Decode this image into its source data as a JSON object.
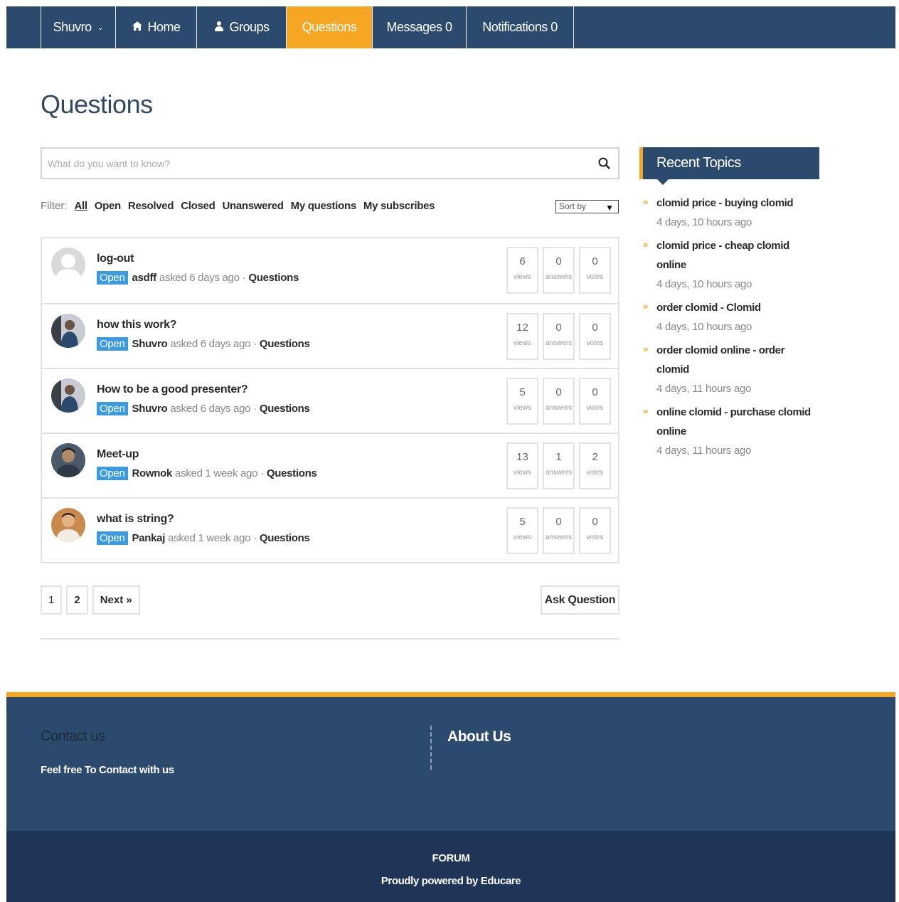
{
  "nav": {
    "user": "Shuvro",
    "home": "Home",
    "groups": "Groups",
    "questions": "Questions",
    "messages": "Messages 0",
    "notifications": "Notifications 0",
    "accent": "#f5a623",
    "bar_color": "#2c4a6e"
  },
  "page": {
    "title": "Questions"
  },
  "search": {
    "placeholder": "What do you want to know?"
  },
  "filter": {
    "label": "Filter:",
    "items": [
      "All",
      "Open",
      "Resolved",
      "Closed",
      "Unanswered",
      "My questions",
      "My subscribes"
    ],
    "sort_label": "Sort by"
  },
  "questions": [
    {
      "title": "log-out",
      "status": "Open",
      "user": "asdff",
      "asked": "asked 6 days ago",
      "category": "Questions",
      "views": "6",
      "answers": "0",
      "votes": "0"
    },
    {
      "title": "how this work?",
      "status": "Open",
      "user": "Shuvro",
      "asked": "asked 6 days ago",
      "category": "Questions",
      "views": "12",
      "answers": "0",
      "votes": "0"
    },
    {
      "title": "How to be a good presenter?",
      "status": "Open",
      "user": "Shuvro",
      "asked": "asked 6 days ago",
      "category": "Questions",
      "views": "5",
      "answers": "0",
      "votes": "0"
    },
    {
      "title": "Meet-up",
      "status": "Open",
      "user": "Rownok",
      "asked": "asked 1 week ago",
      "category": "Questions",
      "views": "13",
      "answers": "1",
      "votes": "2"
    },
    {
      "title": "what is string?",
      "status": "Open",
      "user": "Pankaj",
      "asked": "asked 1 week ago",
      "category": "Questions",
      "views": "5",
      "answers": "0",
      "votes": "0"
    }
  ],
  "stat_labels": {
    "views": "views",
    "answers": "answers",
    "votes": "votes"
  },
  "meta_sep": "·",
  "pager": {
    "p1": "1",
    "p2": "2",
    "next": "Next »"
  },
  "ask_button": "Ask Question",
  "sidebar": {
    "title": "Recent Topics",
    "topics": [
      {
        "title": "clomid price - buying clomid",
        "time": "4 days, 10 hours ago"
      },
      {
        "title": "clomid price - cheap clomid online",
        "time": "4 days, 10 hours ago"
      },
      {
        "title": "order clomid - Clomid",
        "time": "4 days, 10 hours ago"
      },
      {
        "title": "order clomid online - order clomid",
        "time": "4 days, 11 hours ago"
      },
      {
        "title": "online clomid - purchase clomid online",
        "time": "4 days, 11 hours ago"
      }
    ]
  },
  "footer": {
    "contact_heading": "Contact us",
    "contact_text": "Feel free To Contact with us",
    "about_heading": "About Us",
    "site_name": "FORUM",
    "powered": "Proudly powered by Educare"
  }
}
